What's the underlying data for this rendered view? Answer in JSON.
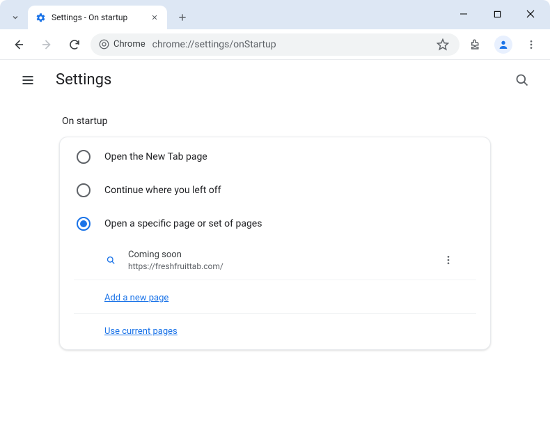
{
  "titlebar": {
    "tab_title": "Settings - On startup"
  },
  "toolbar": {
    "chip_label": "Chrome",
    "url": "chrome://settings/onStartup"
  },
  "header": {
    "title": "Settings"
  },
  "section": {
    "title": "On startup",
    "options": [
      {
        "label": "Open the New Tab page",
        "selected": false
      },
      {
        "label": "Continue where you left off",
        "selected": false
      },
      {
        "label": "Open a specific page or set of pages",
        "selected": true
      }
    ],
    "page": {
      "title": "Coming soon",
      "url": "https://freshfruittab.com/"
    },
    "add_link": "Add a new page",
    "current_link": "Use current pages"
  }
}
